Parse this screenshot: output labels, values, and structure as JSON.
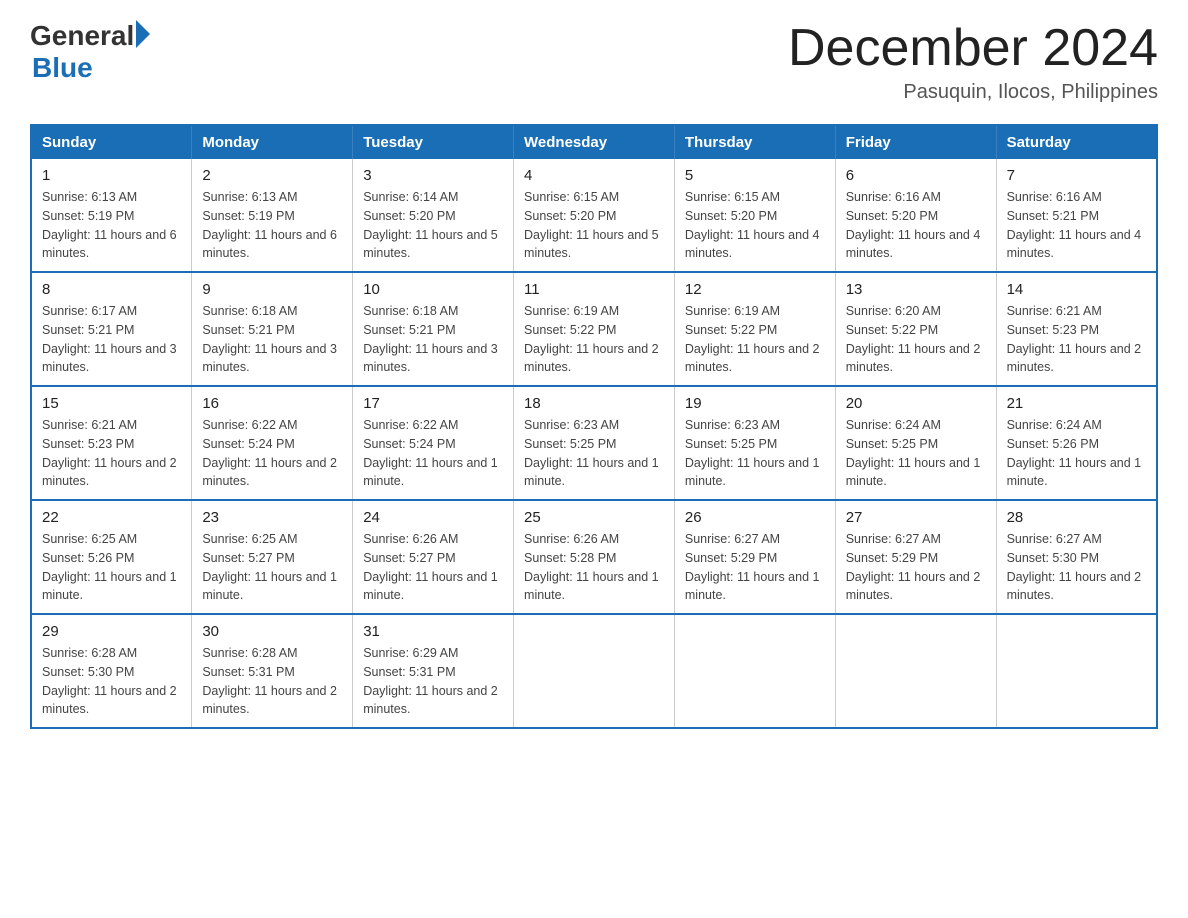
{
  "logo": {
    "general": "General",
    "blue": "Blue"
  },
  "title": "December 2024",
  "location": "Pasuquin, Ilocos, Philippines",
  "days_of_week": [
    "Sunday",
    "Monday",
    "Tuesday",
    "Wednesday",
    "Thursday",
    "Friday",
    "Saturday"
  ],
  "weeks": [
    [
      {
        "day": "1",
        "sunrise": "6:13 AM",
        "sunset": "5:19 PM",
        "daylight": "11 hours and 6 minutes."
      },
      {
        "day": "2",
        "sunrise": "6:13 AM",
        "sunset": "5:19 PM",
        "daylight": "11 hours and 6 minutes."
      },
      {
        "day": "3",
        "sunrise": "6:14 AM",
        "sunset": "5:20 PM",
        "daylight": "11 hours and 5 minutes."
      },
      {
        "day": "4",
        "sunrise": "6:15 AM",
        "sunset": "5:20 PM",
        "daylight": "11 hours and 5 minutes."
      },
      {
        "day": "5",
        "sunrise": "6:15 AM",
        "sunset": "5:20 PM",
        "daylight": "11 hours and 4 minutes."
      },
      {
        "day": "6",
        "sunrise": "6:16 AM",
        "sunset": "5:20 PM",
        "daylight": "11 hours and 4 minutes."
      },
      {
        "day": "7",
        "sunrise": "6:16 AM",
        "sunset": "5:21 PM",
        "daylight": "11 hours and 4 minutes."
      }
    ],
    [
      {
        "day": "8",
        "sunrise": "6:17 AM",
        "sunset": "5:21 PM",
        "daylight": "11 hours and 3 minutes."
      },
      {
        "day": "9",
        "sunrise": "6:18 AM",
        "sunset": "5:21 PM",
        "daylight": "11 hours and 3 minutes."
      },
      {
        "day": "10",
        "sunrise": "6:18 AM",
        "sunset": "5:21 PM",
        "daylight": "11 hours and 3 minutes."
      },
      {
        "day": "11",
        "sunrise": "6:19 AM",
        "sunset": "5:22 PM",
        "daylight": "11 hours and 2 minutes."
      },
      {
        "day": "12",
        "sunrise": "6:19 AM",
        "sunset": "5:22 PM",
        "daylight": "11 hours and 2 minutes."
      },
      {
        "day": "13",
        "sunrise": "6:20 AM",
        "sunset": "5:22 PM",
        "daylight": "11 hours and 2 minutes."
      },
      {
        "day": "14",
        "sunrise": "6:21 AM",
        "sunset": "5:23 PM",
        "daylight": "11 hours and 2 minutes."
      }
    ],
    [
      {
        "day": "15",
        "sunrise": "6:21 AM",
        "sunset": "5:23 PM",
        "daylight": "11 hours and 2 minutes."
      },
      {
        "day": "16",
        "sunrise": "6:22 AM",
        "sunset": "5:24 PM",
        "daylight": "11 hours and 2 minutes."
      },
      {
        "day": "17",
        "sunrise": "6:22 AM",
        "sunset": "5:24 PM",
        "daylight": "11 hours and 1 minute."
      },
      {
        "day": "18",
        "sunrise": "6:23 AM",
        "sunset": "5:25 PM",
        "daylight": "11 hours and 1 minute."
      },
      {
        "day": "19",
        "sunrise": "6:23 AM",
        "sunset": "5:25 PM",
        "daylight": "11 hours and 1 minute."
      },
      {
        "day": "20",
        "sunrise": "6:24 AM",
        "sunset": "5:25 PM",
        "daylight": "11 hours and 1 minute."
      },
      {
        "day": "21",
        "sunrise": "6:24 AM",
        "sunset": "5:26 PM",
        "daylight": "11 hours and 1 minute."
      }
    ],
    [
      {
        "day": "22",
        "sunrise": "6:25 AM",
        "sunset": "5:26 PM",
        "daylight": "11 hours and 1 minute."
      },
      {
        "day": "23",
        "sunrise": "6:25 AM",
        "sunset": "5:27 PM",
        "daylight": "11 hours and 1 minute."
      },
      {
        "day": "24",
        "sunrise": "6:26 AM",
        "sunset": "5:27 PM",
        "daylight": "11 hours and 1 minute."
      },
      {
        "day": "25",
        "sunrise": "6:26 AM",
        "sunset": "5:28 PM",
        "daylight": "11 hours and 1 minute."
      },
      {
        "day": "26",
        "sunrise": "6:27 AM",
        "sunset": "5:29 PM",
        "daylight": "11 hours and 1 minute."
      },
      {
        "day": "27",
        "sunrise": "6:27 AM",
        "sunset": "5:29 PM",
        "daylight": "11 hours and 2 minutes."
      },
      {
        "day": "28",
        "sunrise": "6:27 AM",
        "sunset": "5:30 PM",
        "daylight": "11 hours and 2 minutes."
      }
    ],
    [
      {
        "day": "29",
        "sunrise": "6:28 AM",
        "sunset": "5:30 PM",
        "daylight": "11 hours and 2 minutes."
      },
      {
        "day": "30",
        "sunrise": "6:28 AM",
        "sunset": "5:31 PM",
        "daylight": "11 hours and 2 minutes."
      },
      {
        "day": "31",
        "sunrise": "6:29 AM",
        "sunset": "5:31 PM",
        "daylight": "11 hours and 2 minutes."
      },
      null,
      null,
      null,
      null
    ]
  ]
}
